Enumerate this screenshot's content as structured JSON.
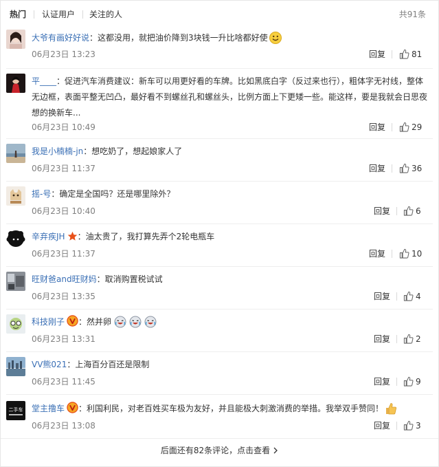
{
  "tabs": [
    {
      "label": "热门"
    },
    {
      "label": "认证用户"
    },
    {
      "label": "关注的人"
    }
  ],
  "total_label": "共91条",
  "reply_label": "回复",
  "comments": [
    {
      "user": "大爷有画好好说",
      "text": "：这都没用，就把油价降到3块钱一升比啥都好使",
      "time": "06月23日 13:23",
      "likes": "81",
      "emoji": "smile-emoji",
      "avatar": "woman-portrait-avatar"
    },
    {
      "user": "平____",
      "text": "：促进汽车消费建议：新车可以用更好看的车牌。比如黑底白字（反过来也行），粗体字无衬线，整体无边框，表面平整无凹凸，最好看不到螺丝孔和螺丝头，比例方面上下更矮一些。能这样，要是我就会日思夜想的换新车...",
      "time": "06月23日 10:49",
      "likes": "29",
      "avatar": "red-figure-avatar"
    },
    {
      "user": "我是小楠楠-jn",
      "text": "：想吃奶了，想起娘家人了",
      "time": "06月23日 11:37",
      "likes": "36",
      "avatar": "beach-avatar"
    },
    {
      "user": "摇-号",
      "text": "：确定是全国吗？还是哪里除外？",
      "time": "06月23日 10:40",
      "likes": "6",
      "avatar": "cartoon-cat-avatar"
    },
    {
      "user": "辛弃疾JH",
      "text": "：油太贵了，我打算先弄个2轮电瓶车",
      "time": "06月23日 11:37",
      "likes": "10",
      "badge": "star-badge-icon",
      "avatar": "black-afro-avatar"
    },
    {
      "user": "旺财爸and旺财妈",
      "text": "：取消购置税试试",
      "time": "06月23日 13:35",
      "likes": "4",
      "avatar": "room-photo-avatar"
    },
    {
      "user": "科技刚子",
      "text": "：然并卵",
      "time": "06月23日 13:31",
      "likes": "2",
      "badge": "vip-v-badge-icon",
      "emoji": "laugh-cry-emoji",
      "avatar": "cartoon-glasses-avatar"
    },
    {
      "user": "VV熊021",
      "text": "：上海百分百还是限制",
      "time": "06月23日 11:45",
      "likes": "9",
      "avatar": "city-skyline-avatar"
    },
    {
      "user": "堂主撸车",
      "text": "：利国利民，对老百姓买车极为友好，并且能极大刺激消费的举措。我举双手赞同！",
      "time": "06月23日 13:08",
      "likes": "3",
      "badge": "vip-v-badge-icon",
      "emoji": "thumbs-up-emoji",
      "avatar": "ershouche-logo-avatar",
      "avatar_text": "二手车"
    }
  ],
  "more_label": "后面还有82条评论，点击查看",
  "colors": {
    "username": "#3a6fb5",
    "meta": "#808080",
    "text": "#333333",
    "divider": "#eeeeee",
    "vip_badge": "#e8511a"
  }
}
